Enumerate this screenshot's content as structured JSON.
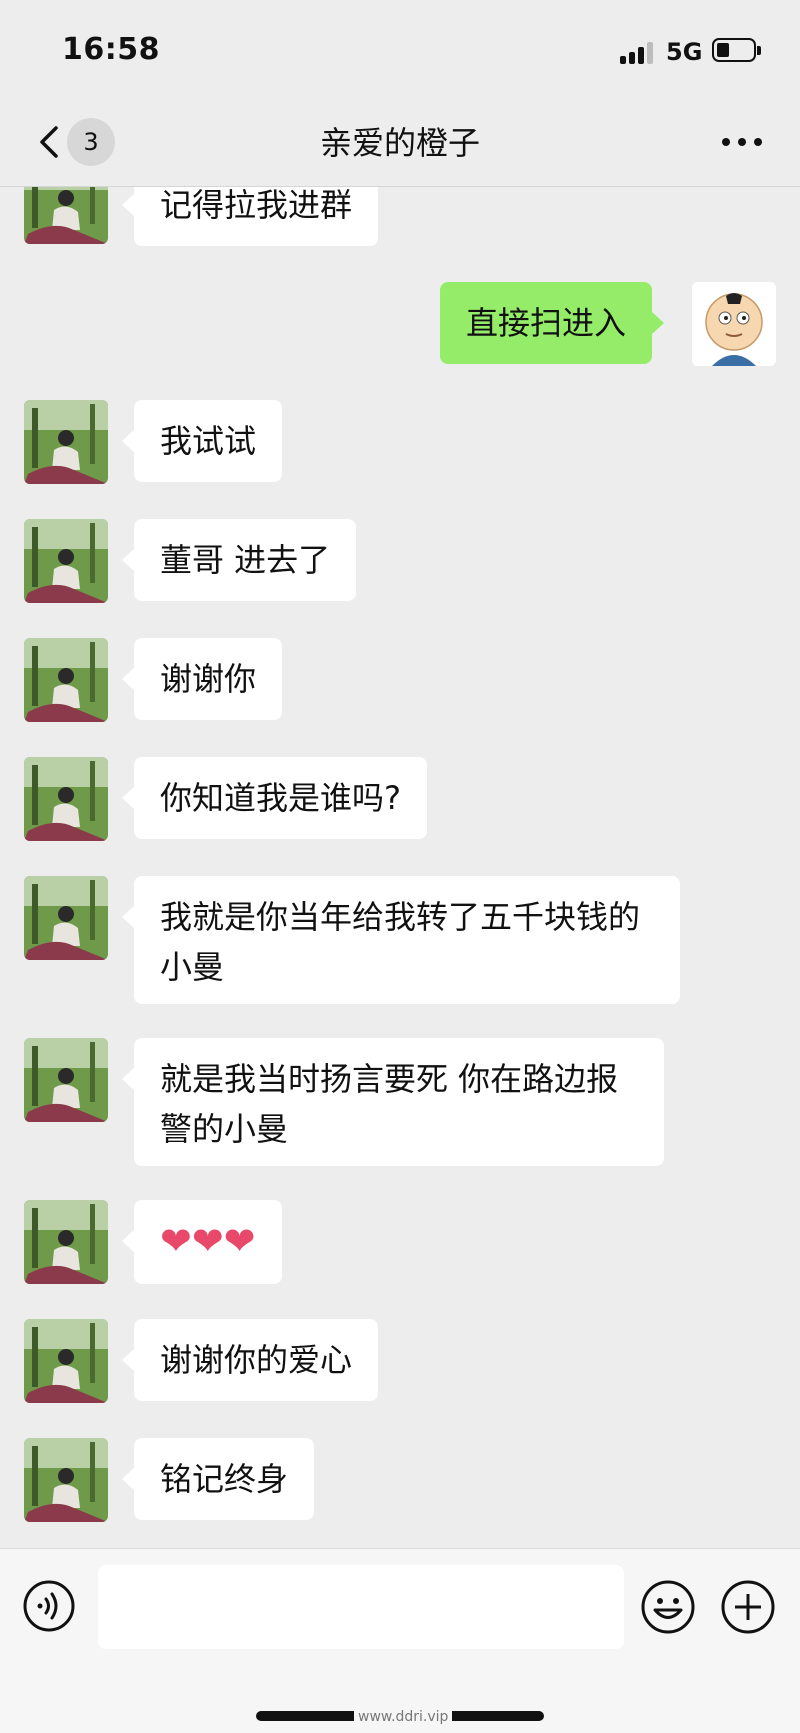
{
  "status_bar": {
    "time": "16:58",
    "network": "5G"
  },
  "nav": {
    "badge_count": "3",
    "title": "亲爱的橙子"
  },
  "messages": [
    {
      "side": "left",
      "text": "记得拉我进群"
    },
    {
      "side": "right",
      "text": "直接扫进入"
    },
    {
      "side": "left",
      "text": "我试试"
    },
    {
      "side": "left",
      "text": "董哥 进去了"
    },
    {
      "side": "left",
      "text": "谢谢你"
    },
    {
      "side": "left",
      "text": "你知道我是谁吗?"
    },
    {
      "side": "left",
      "text": "我就是你当年给我转了五千块钱的小曼"
    },
    {
      "side": "left",
      "text": "就是我当时扬言要死  你在路边报警的小曼"
    },
    {
      "side": "left",
      "text": "❤❤❤"
    },
    {
      "side": "left",
      "text": "谢谢你的爱心"
    },
    {
      "side": "left",
      "text": "铭记终身"
    }
  ],
  "input": {
    "placeholder": ""
  },
  "watermark": "www.ddri.vip",
  "colors": {
    "background": "#ededed",
    "bubble_in": "#ffffff",
    "bubble_out": "#95ec69",
    "heart": "#e8486a"
  }
}
